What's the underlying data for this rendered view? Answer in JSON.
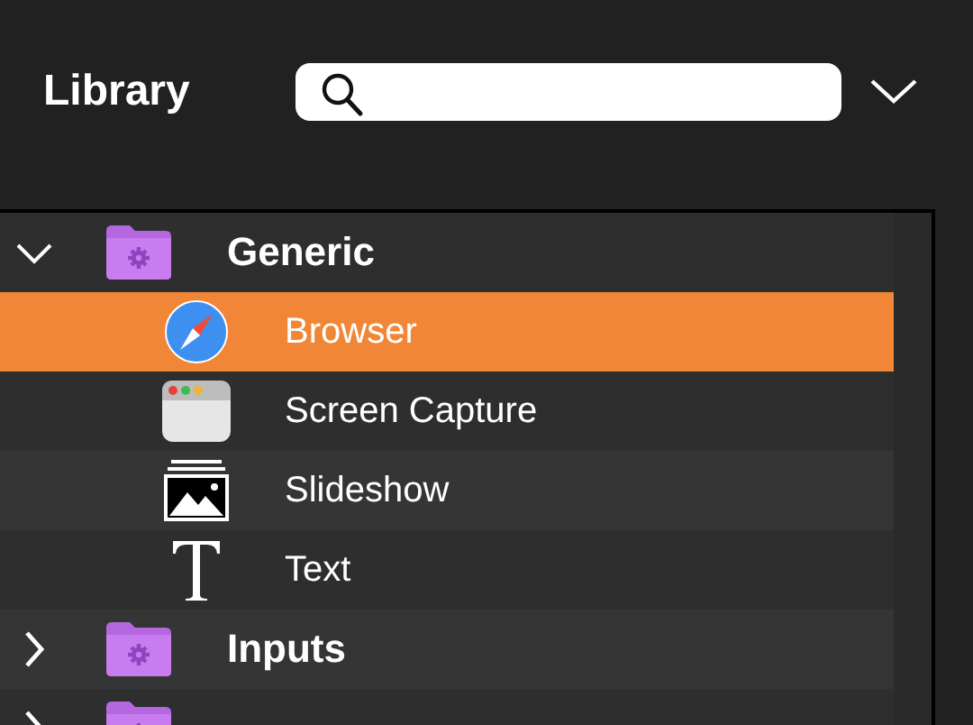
{
  "header": {
    "title": "Library"
  },
  "tree": [
    {
      "label": "Generic",
      "expanded": true,
      "selected": false,
      "children": [
        {
          "label": "Browser",
          "kind": "browser",
          "selected": true
        },
        {
          "label": "Screen Capture",
          "kind": "window",
          "selected": false
        },
        {
          "label": "Slideshow",
          "kind": "slideshow",
          "selected": false
        },
        {
          "label": "Text",
          "kind": "text",
          "selected": false
        }
      ]
    },
    {
      "label": "Inputs",
      "expanded": false,
      "selected": false
    },
    {
      "expanded": false,
      "selected": false
    }
  ]
}
